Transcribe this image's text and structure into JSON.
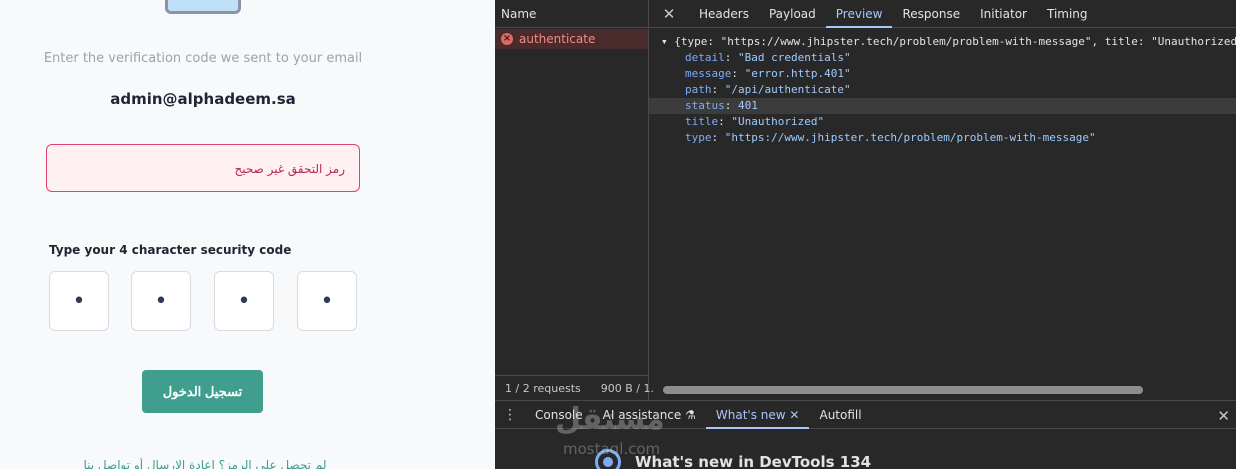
{
  "verify_page": {
    "subtitle": "Enter the verification code we sent to your email",
    "email": "admin@alphadeem.sa",
    "error_message": "رمز التحقق غير صحيح",
    "code_label": "Type your 4 character security code",
    "code_digits": [
      "•",
      "•",
      "•",
      "•"
    ],
    "login_button": "تسجيل الدخول",
    "resend_text": "لم تحصل على الرمز؟ إعادة الإرسال أو تواصل بنا"
  },
  "devtools": {
    "name_header": "Name",
    "requests": [
      {
        "name": "authenticate",
        "status_icon": "error-icon",
        "failed": true
      }
    ],
    "status_requests": "1 / 2 requests",
    "status_size": "900 B / 1.",
    "tabs": [
      "Headers",
      "Payload",
      "Preview",
      "Response",
      "Initiator",
      "Timing"
    ],
    "active_tab": "Preview",
    "preview": {
      "summary": "{type: \"https://www.jhipster.tech/problem/problem-with-message\", title: \"Unauthorized\"",
      "fields": [
        {
          "key": "detail",
          "value": "\"Bad credentials\""
        },
        {
          "key": "message",
          "value": "\"error.http.401\""
        },
        {
          "key": "path",
          "value": "\"/api/authenticate\""
        },
        {
          "key": "status",
          "value": "401"
        },
        {
          "key": "title",
          "value": "\"Unauthorized\""
        },
        {
          "key": "type",
          "value": "\"https://www.jhipster.tech/problem/problem-with-message\""
        }
      ]
    },
    "drawer": {
      "tabs": [
        "Console",
        "AI assistance",
        "What's new",
        "Autofill"
      ],
      "active_tab": "What's new",
      "headline": "What's new in DevTools 134"
    },
    "watermark": "مستقل",
    "watermark_sub": "mostaql.com"
  },
  "colors": {
    "accent_green": "#3f9e8e",
    "error_red": "#e0436b",
    "devtools_bg": "#282828",
    "devtools_accent": "#a8c7fa"
  }
}
